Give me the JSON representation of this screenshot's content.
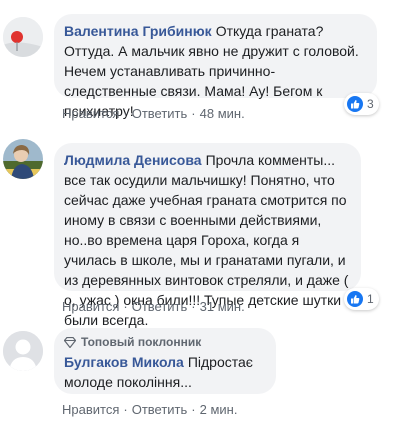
{
  "comments": [
    {
      "author": "Валентина Грибинюк",
      "text": "Откуда граната? Оттуда. А мальчик явно не дружит с головой. Нечем устанавливать причинно-следственные связи. Мама! Ау! Бегом к психиатру!",
      "like_label": "Нравится",
      "reply_label": "Ответить",
      "time": "48 мин.",
      "reaction_count": "3"
    },
    {
      "author": "Людмила Денисова",
      "text": "Прочла комменты... все так осудили мальчишку! Понятно, что сейчас даже учебная граната смотрится по иному в связи с военными действиями, но..во времена царя Гороха, когда я училась в школе, мы и гранатами пугали, и из деревянных винтовок стреляли, и даже ( о, ужас ) окна били!!! Тупые детские шутки были всегда.",
      "like_label": "Нравится",
      "reply_label": "Ответить",
      "time": "31 мин.",
      "reaction_count": "1"
    },
    {
      "badge": "Топовый поклонник",
      "author": "Булгаков Микола",
      "text": "Підростає молоде покоління...",
      "like_label": "Нравится",
      "reply_label": "Ответить",
      "time": "2 мин."
    }
  ],
  "colors": {
    "author": "#385898",
    "bubble": "#f2f3f5",
    "meta": "#606770",
    "like": "#1877f2"
  }
}
